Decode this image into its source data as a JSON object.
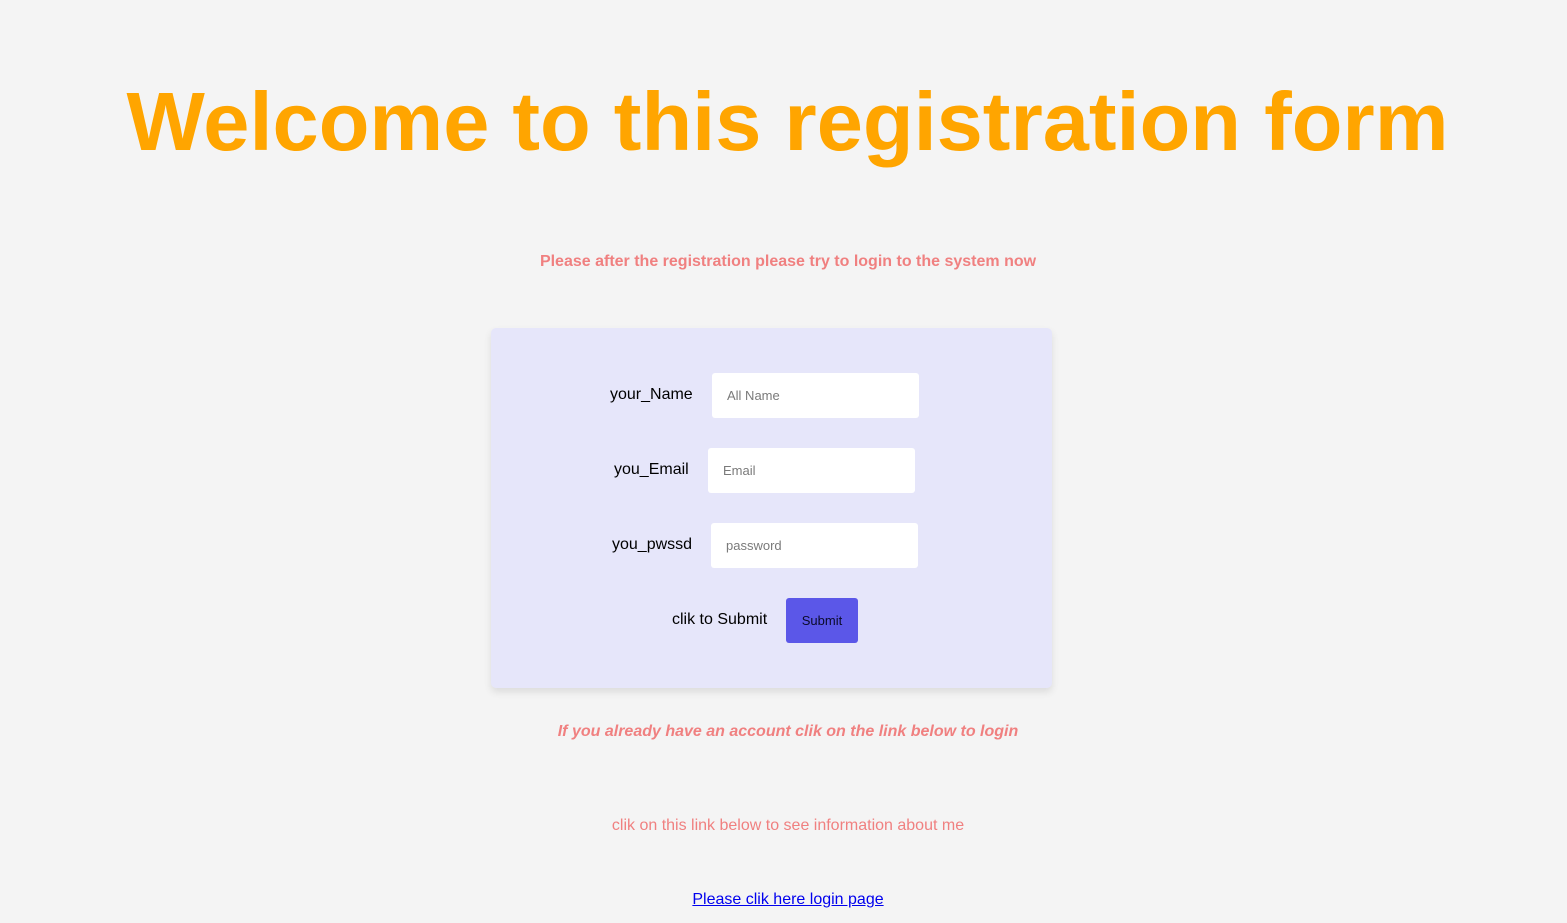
{
  "header": {
    "title": "Welcome to this registration form",
    "subtitle": "Please after the registration please try to login to the system now"
  },
  "form": {
    "name_label": "your_Name",
    "name_placeholder": "All Name",
    "email_label": "you_Email",
    "email_placeholder": "Email",
    "password_label": "you_pwssd",
    "password_placeholder": "password",
    "submit_label": "clik to Submit",
    "submit_button": "Submit"
  },
  "footer": {
    "account_note": "If you already have an account clik on the link below to login",
    "about_note": "clik on this link below to see information about me",
    "login_link": "Please clik here login page"
  },
  "colors": {
    "background": "#f4f4f4",
    "title": "#ffa500",
    "accent_text": "#f08080",
    "card": "#e6e6fa",
    "button": "#5b57e8",
    "link": "#0000ee"
  }
}
